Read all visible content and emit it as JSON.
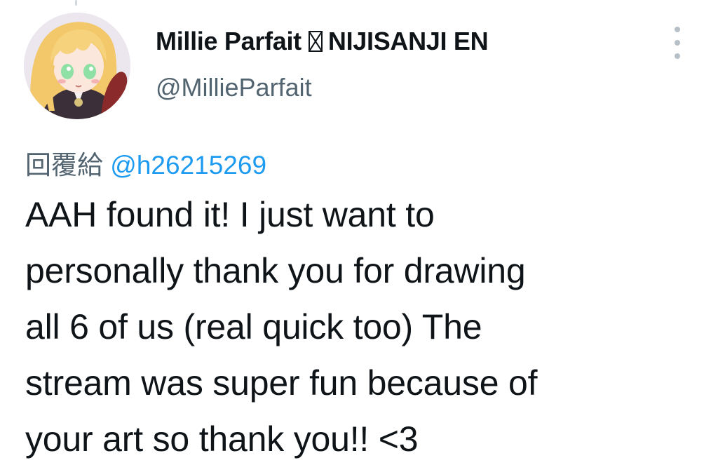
{
  "tweet": {
    "author": {
      "display_name": "Millie Parfait",
      "display_name_suffix": "NIJISANJI EN",
      "handle": "@MillieParfait",
      "avatar": "anime-girl-avatar"
    },
    "reply_prefix": "回覆給",
    "reply_to_handle": "@h26215269",
    "text": "AAH found it! I just want to\npersonally thank you for drawing\nall 6 of us (real quick too) The\nstream was super fun because of\nyour art so thank you!! <3",
    "icons": {
      "more": "more-vertical-icon",
      "badge": "missing-glyph-box"
    },
    "colors": {
      "text": "#0f1419",
      "muted": "#536471",
      "link": "#1d9bf0",
      "more_dots": "#b7c0c7"
    }
  }
}
